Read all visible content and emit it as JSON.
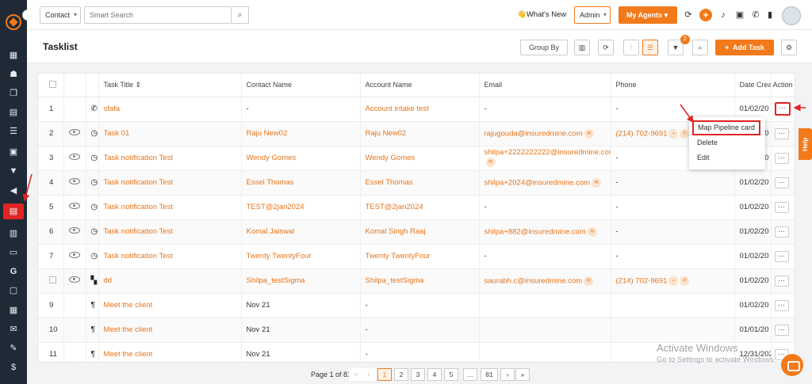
{
  "topbar": {
    "entity_select": "Contact",
    "search_placeholder": "Smart Search",
    "whats_new": "👋What's New",
    "admin_select": "Admin",
    "agents_button": "My Agents"
  },
  "subheader": {
    "title": "Tasklist",
    "group_by": "Group By",
    "filter_count": "2",
    "add_task": "Add Task"
  },
  "table": {
    "columns": [
      "Task Title ⇕",
      "Contact Name",
      "Account Name",
      "Email",
      "Phone",
      "Date Crea",
      "Action"
    ],
    "rows": [
      {
        "num": "1",
        "title": "sfafa",
        "contact": "-",
        "account": "Account intake test",
        "email": "-",
        "phone": "-",
        "date": "01/02/20"
      },
      {
        "num": "2",
        "title": "Task 01",
        "contact": "Raju New02",
        "account": "Raju New02",
        "email": "rajugouda@insuredmine.com",
        "phone": "(214) 702-9691",
        "date": "01/02/20"
      },
      {
        "num": "3",
        "title": "Task notification Test",
        "contact": "Wendy Gomes",
        "account": "Wendy Gomes",
        "email": "shilpa+2222222222@insuredmine.com",
        "phone": "-",
        "date": "01/02/20"
      },
      {
        "num": "4",
        "title": "Task notification Test",
        "contact": "Essel Thomas",
        "account": "Essel Thomas",
        "email": "shilpa+2024@insuredmine.com",
        "phone": "-",
        "date": "01/02/20"
      },
      {
        "num": "5",
        "title": "Task notification Test",
        "contact": "TEST@2jan2024",
        "account": "TEST@2jan2024",
        "email": "-",
        "phone": "-",
        "date": "01/02/20"
      },
      {
        "num": "6",
        "title": "Task notification Test",
        "contact": "Komal Jaiswal",
        "account": "Komal Singh Raaj",
        "email": "shilpa+882@insuredmine.com",
        "phone": "-",
        "date": "01/02/20"
      },
      {
        "num": "7",
        "title": "Task notification Test",
        "contact": "Twenty TwentyFour",
        "account": "Twenty TwentyFour",
        "email": "-",
        "phone": "-",
        "date": "01/02/20"
      },
      {
        "num": "",
        "title": "dd",
        "contact": "Shilpa_testSigma",
        "account": "Shilpa_testSigma",
        "email": "saurabh.c@insuredmine.com",
        "phone": "(214) 702-9691",
        "date": "01/02/20"
      },
      {
        "num": "9",
        "title": "Meet the client",
        "contact": "Nov 21",
        "account": "-",
        "email": "",
        "phone": "",
        "date": "01/02/20"
      },
      {
        "num": "10",
        "title": "Meet the client",
        "contact": "Nov 21",
        "account": "-",
        "email": "",
        "phone": "",
        "date": "01/01/20"
      },
      {
        "num": "11",
        "title": "Meet the client",
        "contact": "Nov 21",
        "account": "-",
        "email": "",
        "phone": "",
        "date": "12/31/202"
      }
    ]
  },
  "action_menu": {
    "items": [
      "Map Pipeline card",
      "Delete",
      "Edit"
    ]
  },
  "help_tab": "Help",
  "pagination": {
    "text": "Page 1 of 81",
    "first": "«",
    "prev": "‹",
    "pages": [
      "1",
      "2",
      "3",
      "4",
      "5",
      "...",
      "81"
    ],
    "next": "›",
    "last": "»"
  },
  "watermark": {
    "line1": "Activate Windows",
    "line2": "Go to Settings to activate Windows."
  },
  "colors": {
    "accent": "#f27a1a",
    "sidebar": "#1f2a36",
    "annotation": "#e02424"
  }
}
